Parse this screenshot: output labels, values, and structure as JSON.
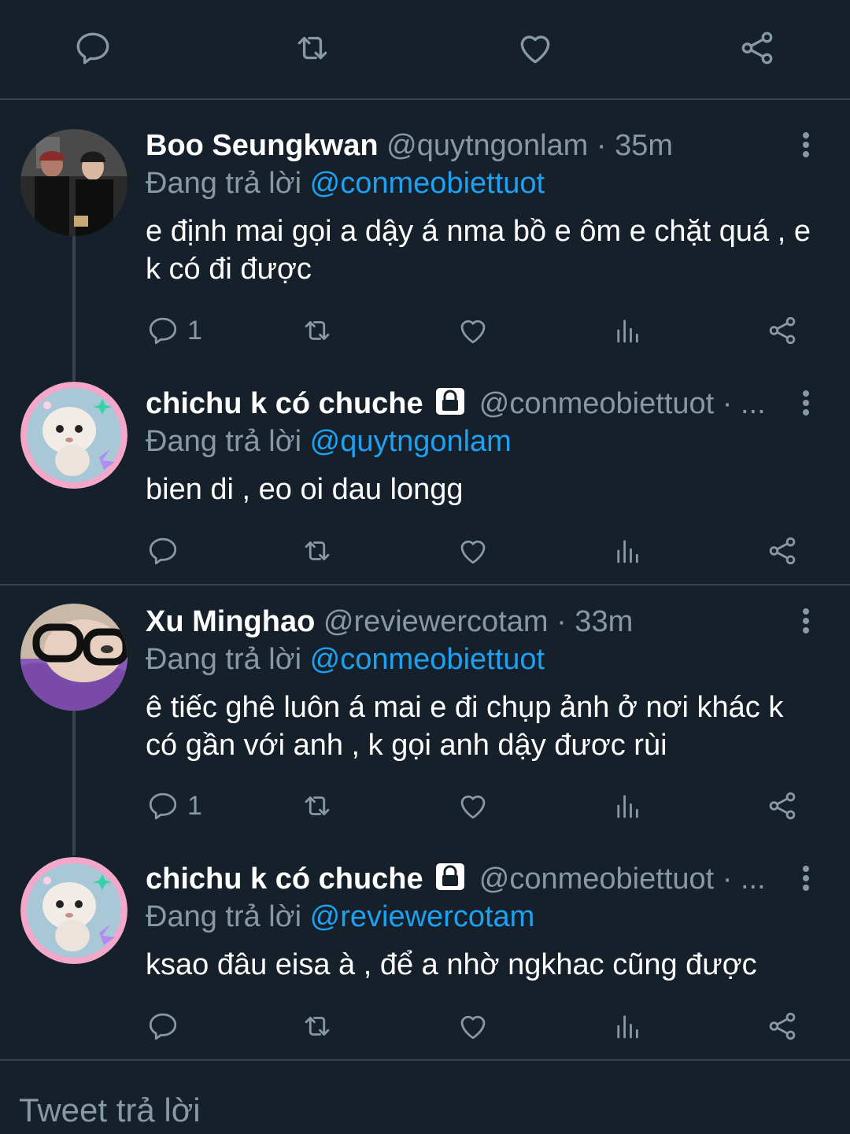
{
  "topbar": {
    "icons": [
      "reply-icon",
      "retweet-icon",
      "like-icon",
      "share-icon"
    ]
  },
  "tweets": [
    {
      "display_name": "Boo Seungkwan",
      "handle": "@quytngonlam",
      "time": "· 35m",
      "reply_prefix": "Đang trả lời",
      "reply_to": "@conmeobiettuot",
      "text": "e định mai gọi a dậy á  nma bồ e ôm e chặt quá , e k có đi được",
      "reply_count": "1",
      "locked": false
    },
    {
      "display_name": "chichu k có chuche",
      "handle": "@conmeobiettuot",
      "time": "· ...",
      "reply_prefix": "Đang trả lời",
      "reply_to": "@quytngonlam",
      "text": "bien di , eo oi dau longg",
      "reply_count": "",
      "locked": true
    },
    {
      "display_name": "Xu Minghao",
      "handle": "@reviewercotam",
      "time": "· 33m",
      "reply_prefix": "Đang trả lời",
      "reply_to": "@conmeobiettuot",
      "text": "ê tiếc ghê luôn á mai e đi chụp ảnh ở nơi khác k có gần với anh , k gọi anh dậy đươc rùi",
      "reply_count": "1",
      "locked": false
    },
    {
      "display_name": "chichu k có chuche",
      "handle": "@conmeobiettuot",
      "time": "· ...",
      "reply_prefix": "Đang trả lời",
      "reply_to": "@reviewercotam",
      "text": "ksao đâu eisa à , để a nhờ ngkhac cũng được",
      "reply_count": "",
      "locked": true
    }
  ],
  "composer": {
    "placeholder": "Tweet trả lời"
  },
  "colors": {
    "background": "#15202b",
    "secondary_text": "#8899a6",
    "link": "#1da1f2",
    "divider": "#38444d"
  }
}
